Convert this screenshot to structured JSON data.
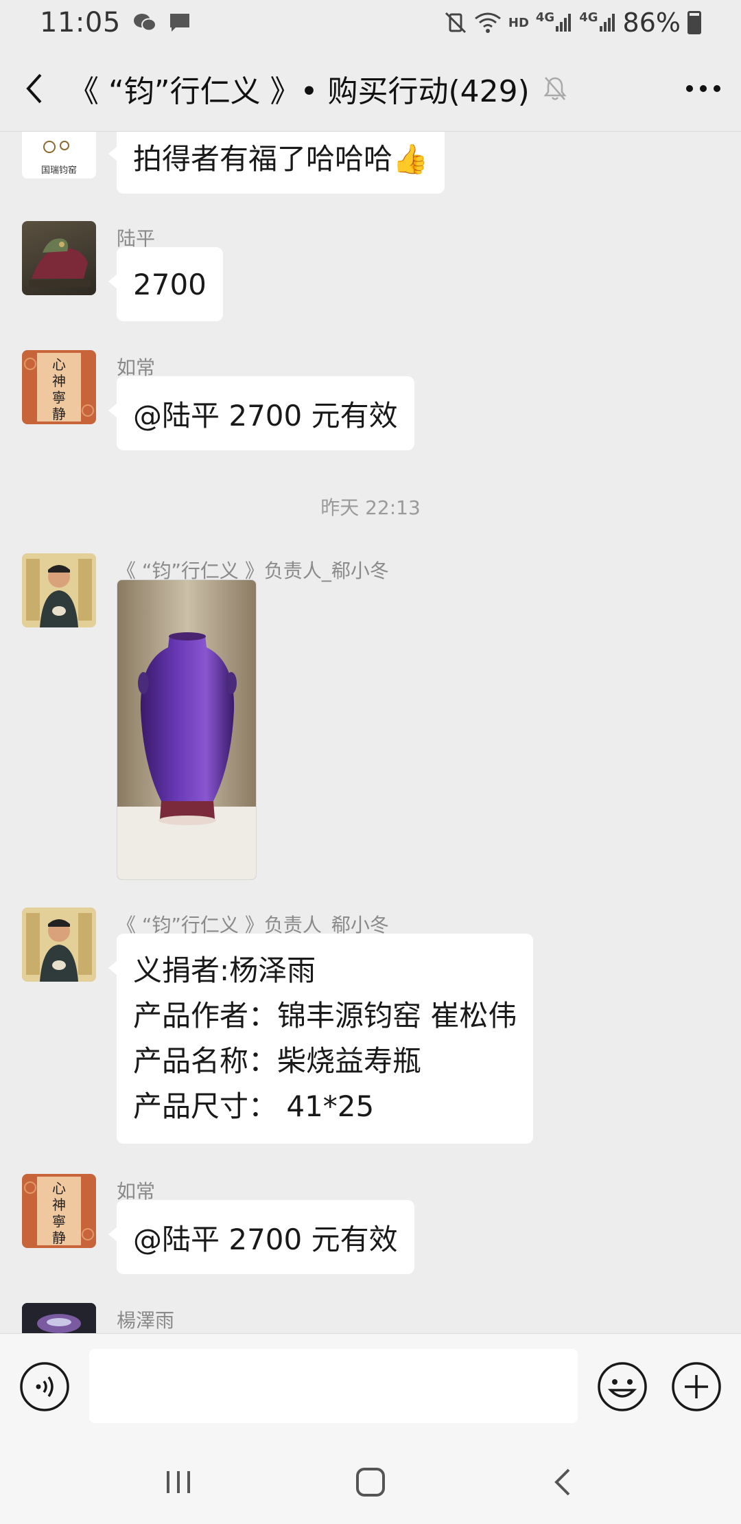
{
  "status_bar": {
    "time": "11:05",
    "network_label": "HD",
    "signal_1": "4G",
    "signal_2": "4G",
    "battery": "86%"
  },
  "header": {
    "title": "《 “钧”行仁义 》• 购买行动(429)"
  },
  "messages": [
    {
      "id": "m0",
      "text": "拍得者有福了哈哈哈👍"
    },
    {
      "id": "m1",
      "sender": "陆平",
      "text": "2700"
    },
    {
      "id": "m2",
      "sender": "如常",
      "text": "@陆平  2700 元有效"
    },
    {
      "id": "ts",
      "timestamp": "昨天 22:13"
    },
    {
      "id": "m3",
      "sender": "《 “钧”行仁义 》负责人_郗小冬",
      "image": "purple-glazed-vase-photo"
    },
    {
      "id": "m4",
      "sender": "《 “钧”行仁义 》负责人_郗小冬",
      "lines": [
        "义捐者:杨泽雨",
        "产品作者：锦丰源钧窑  崔松伟",
        "产品名称：柴烧益寿瓶",
        "产品尺寸： 41*25"
      ]
    },
    {
      "id": "m5",
      "sender": "如常",
      "text": "@陆平  2700 元有效"
    },
    {
      "id": "m6",
      "sender": "楊澤雨"
    }
  ],
  "avatars": {
    "m0": "museum-logo-avatar",
    "m1": "dragon-statue-avatar",
    "m2": "calligraphy-scroll-avatar",
    "m3": "man-portrait-avatar",
    "m6": "ceramic-vase-avatar"
  },
  "avatar_text": {
    "m0": "国瑞钧窑",
    "m2": [
      "心",
      "神",
      "寧",
      "静"
    ]
  },
  "colors": {
    "background": "#ededed",
    "bubble": "#ffffff",
    "sender_text": "#8a8a8a",
    "accent_vase": "#5a2a9a"
  }
}
